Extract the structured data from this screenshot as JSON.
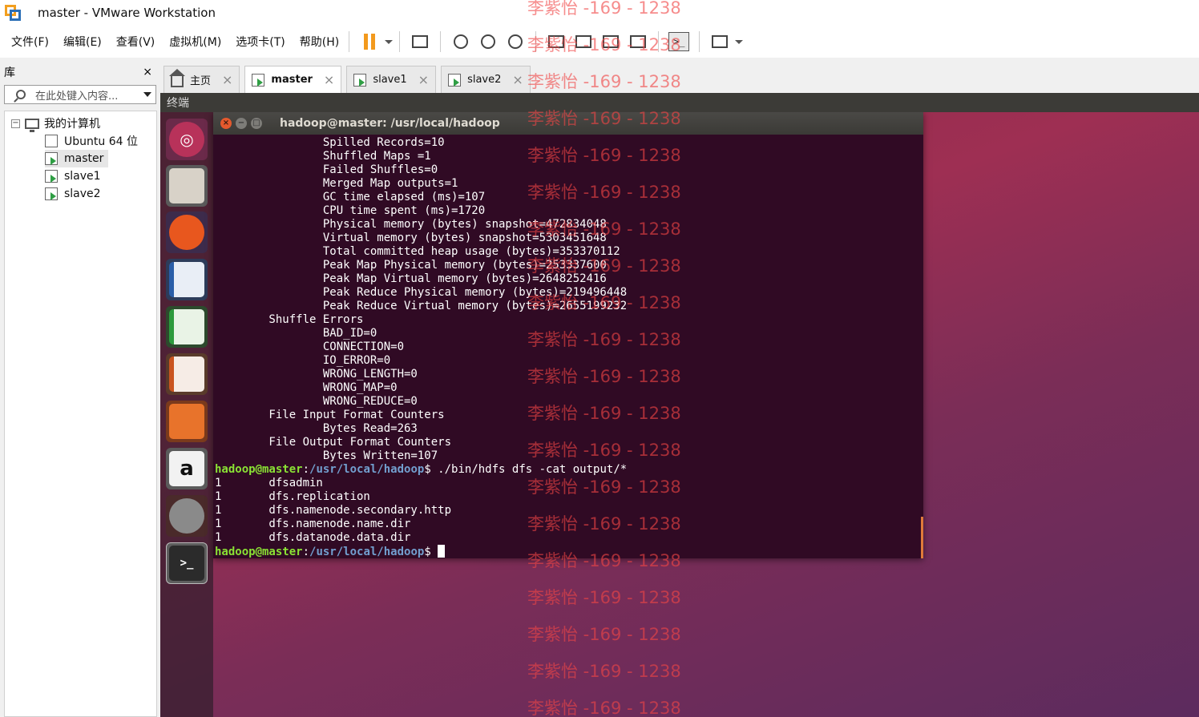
{
  "window": {
    "title": "master - VMware Workstation"
  },
  "menu": [
    "文件(F)",
    "编辑(E)",
    "查看(V)",
    "虚拟机(M)",
    "选项卡(T)",
    "帮助(H)"
  ],
  "toolbar": {
    "terminal_label": ">_"
  },
  "library": {
    "title": "库",
    "close": "×",
    "search_placeholder": "在此处键入内容...",
    "root": "我的计算机",
    "items": [
      "Ubuntu 64 位",
      "master",
      "slave1",
      "slave2"
    ]
  },
  "tabs": [
    {
      "label": "主页",
      "close": "×"
    },
    {
      "label": "master",
      "close": "×"
    },
    {
      "label": "slave1",
      "close": "×"
    },
    {
      "label": "slave2",
      "close": "×"
    }
  ],
  "guest": {
    "header": "终端",
    "terminal_title": "hadoop@master: /usr/local/hadoop",
    "launcher_labels": {
      "amazon": "a",
      "terminal": ">_"
    }
  },
  "terminal": {
    "lines": [
      "                Spilled Records=10",
      "                Shuffled Maps =1",
      "                Failed Shuffles=0",
      "                Merged Map outputs=1",
      "                GC time elapsed (ms)=107",
      "                CPU time spent (ms)=1720",
      "                Physical memory (bytes) snapshot=472834048",
      "                Virtual memory (bytes) snapshot=5303451648",
      "                Total committed heap usage (bytes)=353370112",
      "                Peak Map Physical memory (bytes)=253337600",
      "                Peak Map Virtual memory (bytes)=2648252416",
      "                Peak Reduce Physical memory (bytes)=219496448",
      "                Peak Reduce Virtual memory (bytes)=2655199232",
      "        Shuffle Errors",
      "                BAD_ID=0",
      "                CONNECTION=0",
      "                IO_ERROR=0",
      "                WRONG_LENGTH=0",
      "                WRONG_MAP=0",
      "                WRONG_REDUCE=0",
      "        File Input Format Counters",
      "                Bytes Read=263",
      "        File Output Format Counters",
      "                Bytes Written=107"
    ],
    "prompt_user": "hadoop@master",
    "prompt_sep": ":",
    "prompt_path": "/usr/local/hadoop",
    "prompt_end": "$ ",
    "command": "./bin/hdfs dfs -cat output/*",
    "output": [
      "1       dfsadmin",
      "1       dfs.replication",
      "1       dfs.namenode.secondary.http",
      "1       dfs.namenode.name.dir",
      "1       dfs.datanode.data.dir"
    ]
  },
  "watermark": {
    "text": "李紫怡 -169 - 1238"
  },
  "colors": {
    "terminal_bg": "#300a24",
    "prompt_user": "#8ae234",
    "prompt_path": "#729fcf",
    "accent_pause": "#f39a1d"
  }
}
